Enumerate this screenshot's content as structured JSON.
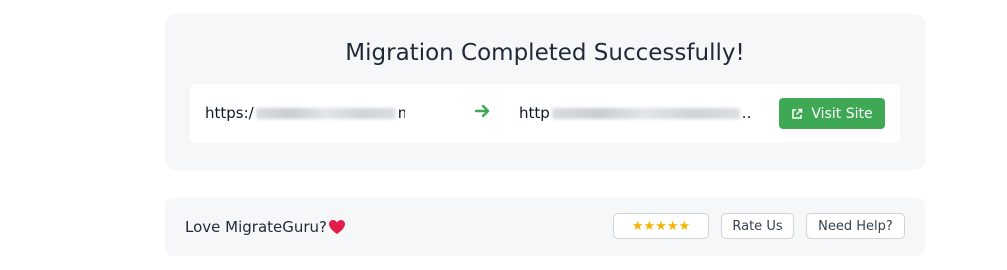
{
  "migration": {
    "title": "Migration Completed Successfully!",
    "source_url_start": "https:/",
    "source_url_end": "m",
    "dest_url_start": "http",
    "dest_url_end": "..",
    "visit_label": "Visit Site"
  },
  "footer": {
    "love_text": "Love MigrateGuru?",
    "stars": "★★★★★",
    "rate_label": "Rate Us",
    "help_label": "Need Help?"
  },
  "colors": {
    "accent_green": "#3ea854",
    "arrow_green": "#3ea854",
    "star_gold": "#f5b301",
    "heart_red": "#e11d48"
  },
  "icons": {
    "arrow": "arrow-right-icon",
    "external": "external-link-icon",
    "heart": "heart-icon"
  }
}
